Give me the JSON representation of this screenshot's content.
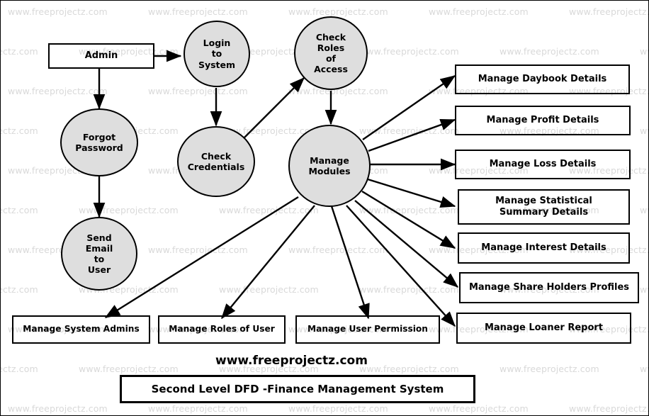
{
  "diagram": {
    "title": "Second Level DFD -Finance Management System",
    "site_credit": "www.freeprojectz.com",
    "watermark_text": "www.freeprojectz.com",
    "colors": {
      "process_fill": "#dedede",
      "stroke": "#000000",
      "watermark": "#d9d9d9",
      "background": "#ffffff"
    }
  },
  "entities": {
    "admin": {
      "label": "Admin"
    }
  },
  "processes": [
    {
      "id": "login-to-system",
      "label": "Login\nto\nSystem"
    },
    {
      "id": "check-roles-of-access",
      "label": "Check\nRoles\nof\nAccess"
    },
    {
      "id": "forgot-password",
      "label": "Forgot\nPassword"
    },
    {
      "id": "check-credentials",
      "label": "Check\nCredentials"
    },
    {
      "id": "manage-modules",
      "label": "Manage\nModules"
    },
    {
      "id": "send-email-to-user",
      "label": "Send\nEmail\nto\nUser"
    }
  ],
  "right_modules": [
    {
      "id": "manage-daybook-details",
      "label": "Manage Daybook Details"
    },
    {
      "id": "manage-profit-details",
      "label": "Manage Profit Details"
    },
    {
      "id": "manage-loss-details",
      "label": "Manage Loss Details"
    },
    {
      "id": "manage-statistical-summary-details",
      "label": "Manage Statistical\nSummary Details"
    },
    {
      "id": "manage-interest-details",
      "label": "Manage Interest Details"
    },
    {
      "id": "manage-share-holders-profiles",
      "label": "Manage Share Holders Profiles"
    },
    {
      "id": "manage-loaner-report",
      "label": "Manage  Loaner Report"
    }
  ],
  "bottom_modules": [
    {
      "id": "manage-system-admins",
      "label": "Manage System Admins"
    },
    {
      "id": "manage-roles-of-user",
      "label": "Manage Roles of User"
    },
    {
      "id": "manage-user-permission",
      "label": "Manage User Permission"
    },
    {
      "id": "manage-loaner-report-bottom",
      "label": "Manage  Loaner Report"
    }
  ],
  "flows": [
    {
      "from": "admin",
      "to": "login-to-system"
    },
    {
      "from": "admin",
      "to": "forgot-password"
    },
    {
      "from": "login-to-system",
      "to": "check-credentials"
    },
    {
      "from": "check-credentials",
      "to": "check-roles-of-access"
    },
    {
      "from": "check-roles-of-access",
      "to": "manage-modules"
    },
    {
      "from": "forgot-password",
      "to": "send-email-to-user"
    },
    {
      "from": "manage-modules",
      "to": "manage-daybook-details"
    },
    {
      "from": "manage-modules",
      "to": "manage-profit-details"
    },
    {
      "from": "manage-modules",
      "to": "manage-loss-details"
    },
    {
      "from": "manage-modules",
      "to": "manage-statistical-summary-details"
    },
    {
      "from": "manage-modules",
      "to": "manage-interest-details"
    },
    {
      "from": "manage-modules",
      "to": "manage-share-holders-profiles"
    },
    {
      "from": "manage-modules",
      "to": "manage-loaner-report"
    },
    {
      "from": "manage-modules",
      "to": "manage-system-admins"
    },
    {
      "from": "manage-modules",
      "to": "manage-roles-of-user"
    },
    {
      "from": "manage-modules",
      "to": "manage-user-permission"
    }
  ]
}
